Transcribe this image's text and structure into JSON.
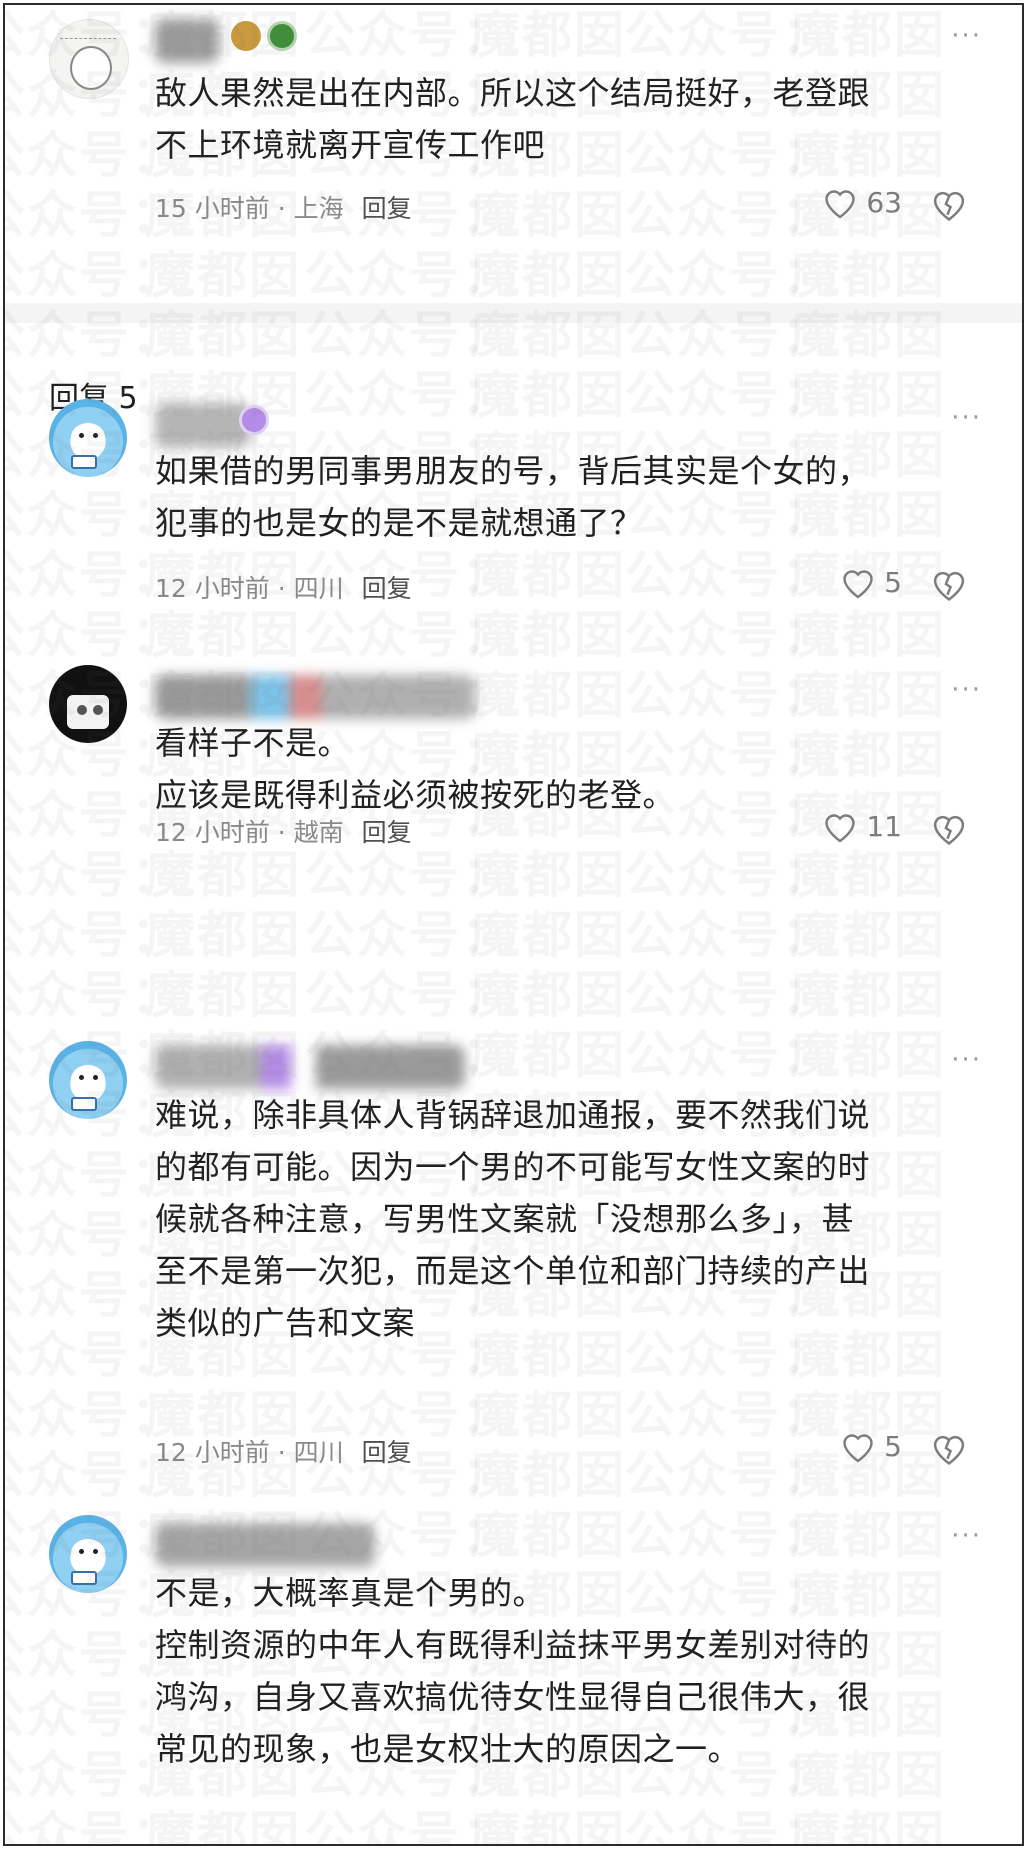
{
  "watermark": {
    "text_a": "公众号：",
    "text_b": "魔都囡"
  },
  "colors": {
    "text_primary": "#1f1f1f",
    "text_secondary": "#8a8a8a",
    "divider": "#f4f4f4",
    "badge_purple": "#b48be6",
    "badge_green": "#3e8e3a",
    "badge_gold": "#c99a3e"
  },
  "first_comment": {
    "text_lines": [
      "敌人果然是出在内部。所以这个结局挺好，老登跟",
      "不上环境就离开宣传工作吧"
    ],
    "time": "15 小时前",
    "location": "上海",
    "reply_label": "回复",
    "likes": "63",
    "icons": [
      "heart-icon",
      "broken-heart-icon",
      "more-icon"
    ]
  },
  "replies_header": {
    "label": "回复 5"
  },
  "comments": [
    {
      "text_lines": [
        "如果借的男同事男朋友的号，背后其实是个女的，",
        "犯事的也是女的是不是就想通了？"
      ],
      "time": "12 小时前",
      "location": "四川",
      "reply_label": "回复",
      "likes": "5"
    },
    {
      "text_lines": [
        "看样子不是。",
        "应该是既得利益必须被按死的老登。"
      ],
      "time": "12 小时前",
      "location": "越南",
      "reply_label": "回复",
      "likes": "11"
    },
    {
      "text_lines": [
        "难说，除非具体人背锅辞退加通报，要不然我们说",
        "的都有可能。因为一个男的不可能写女性文案的时",
        "候就各种注意，写男性文案就「没想那么多」，甚",
        "至不是第一次犯，而是这个单位和部门持续的产出",
        "类似的广告和文案"
      ],
      "time": "12 小时前",
      "location": "四川",
      "reply_label": "回复",
      "likes": "5"
    },
    {
      "text_lines": [
        "不是，大概率真是个男的。",
        "控制资源的中年人有既得利益抹平男女差别对待的",
        "鸿沟，自身又喜欢搞优待女性显得自己很伟大，很",
        "常见的现象，也是女权壮大的原因之一。"
      ]
    }
  ],
  "separator": "·"
}
